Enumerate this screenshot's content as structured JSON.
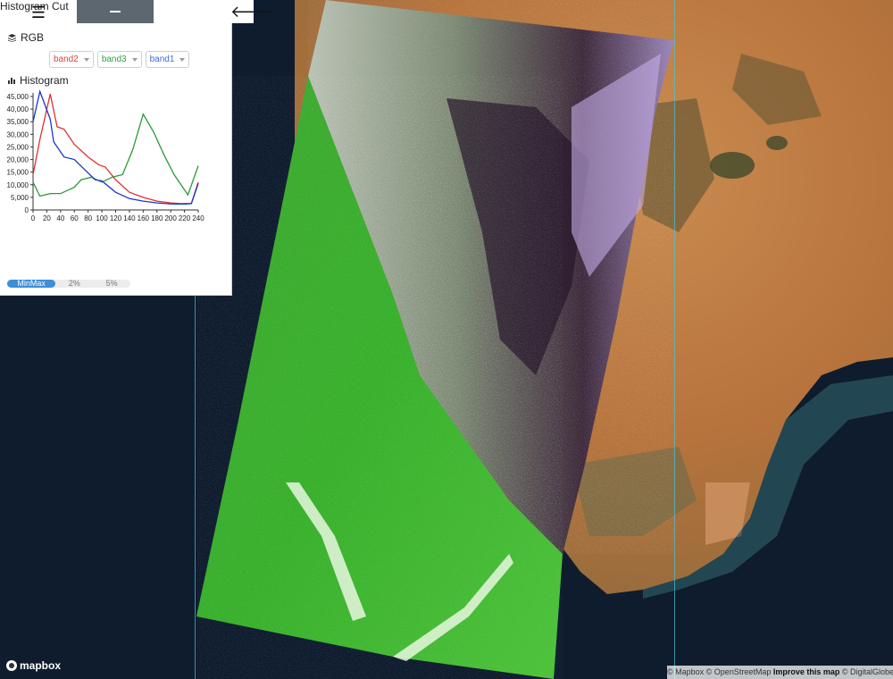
{
  "panel": {
    "menu_icon": "menu-icon",
    "minimize_icon": "minus-icon",
    "back_icon": "arrow-left-icon",
    "rgb_label": "RGB",
    "bands": [
      {
        "label": "band2",
        "color": "#e04040"
      },
      {
        "label": "band3",
        "color": "#2fa33a"
      },
      {
        "label": "band1",
        "color": "#3a6ed8"
      }
    ],
    "histogram_label": "Histogram",
    "histogram_cut_label": "Histogram Cut",
    "cut_options": [
      "MinMax",
      "2%",
      "5%"
    ],
    "cut_selected": "MinMax"
  },
  "chart_data": {
    "type": "line",
    "title": "",
    "xlabel": "",
    "ylabel": "",
    "xlim": [
      0,
      240
    ],
    "ylim": [
      0,
      45000
    ],
    "x_ticks": [
      0,
      20,
      40,
      60,
      80,
      100,
      120,
      140,
      160,
      180,
      200,
      220,
      240
    ],
    "y_ticks": [
      "0",
      "5,000",
      "10,000",
      "15,000",
      "20,000",
      "25,000",
      "30,000",
      "35,000",
      "40,000",
      "45,000"
    ],
    "series": [
      {
        "name": "band2",
        "color": "#e03030",
        "x": [
          0,
          10,
          25,
          35,
          45,
          60,
          80,
          95,
          105,
          120,
          140,
          160,
          180,
          200,
          215,
          230,
          240
        ],
        "y": [
          14000,
          28000,
          46000,
          33000,
          32000,
          26000,
          21000,
          18000,
          17000,
          12000,
          7000,
          5000,
          3500,
          2800,
          2500,
          2600,
          11000
        ]
      },
      {
        "name": "band3",
        "color": "#2a9a35",
        "x": [
          0,
          10,
          25,
          40,
          60,
          70,
          85,
          100,
          115,
          130,
          145,
          160,
          175,
          190,
          205,
          225,
          240
        ],
        "y": [
          11000,
          5500,
          6500,
          6500,
          9000,
          12000,
          13000,
          11000,
          13000,
          14000,
          24000,
          38000,
          31000,
          22000,
          14000,
          6000,
          17500
        ]
      },
      {
        "name": "band1",
        "color": "#1a35c8",
        "x": [
          0,
          10,
          25,
          30,
          45,
          60,
          75,
          90,
          100,
          120,
          140,
          160,
          180,
          200,
          220,
          230,
          240
        ],
        "y": [
          35000,
          47000,
          36000,
          27000,
          21000,
          20000,
          16000,
          12000,
          11500,
          7000,
          4500,
          3500,
          2800,
          2400,
          2300,
          2500,
          10500
        ]
      }
    ]
  },
  "map": {
    "logo_text": "mapbox",
    "logo_icon": "mapbox-logo-icon",
    "attribution_mapbox": "© Mapbox",
    "attribution_osm": "© OpenStreetMap",
    "attribution_improve": "Improve this map",
    "attribution_dg": "© DigitalGlobe"
  }
}
